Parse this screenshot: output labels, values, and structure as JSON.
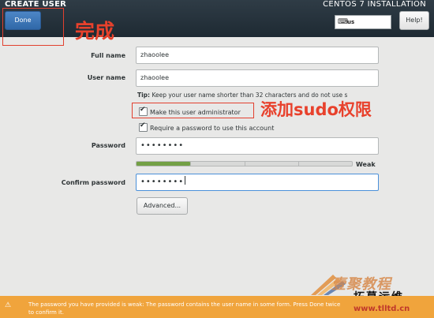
{
  "header": {
    "title": "CREATE USER",
    "done_label": "Done",
    "install_title": "CENTOS 7 INSTALLATION",
    "keyboard": {
      "icon": "keyboard-icon",
      "layout": "us"
    },
    "help_label": "Help!"
  },
  "form": {
    "full_name": {
      "label": "Full name",
      "value": "zhaoolee"
    },
    "user_name": {
      "label": "User name",
      "value": "zhaoolee"
    },
    "tip_prefix": "Tip:",
    "tip_text": " Keep your user name shorter than 32 characters and do not use s",
    "make_admin": {
      "label": "Make this user administrator",
      "checked": true
    },
    "require_password": {
      "label": "Require a password to use this account",
      "checked": true
    },
    "password": {
      "label": "Password",
      "value": "••••••••"
    },
    "strength": {
      "label": "Weak",
      "level": 0.25
    },
    "confirm_password": {
      "label": "Confirm password",
      "value": "••••••••"
    },
    "advanced_label": "Advanced..."
  },
  "annotations": {
    "done_note": "完成",
    "admin_note": "添加sudo权限"
  },
  "warning": {
    "text": "The password you have provided is weak: The password contains the user name in some form. Press Done twice to confirm it."
  },
  "watermark": {
    "line1": "壹聚教程",
    "line2": "拓幕运维",
    "line3": "www.tlltd.cn"
  },
  "colors": {
    "header_bg": "#26323b",
    "accent_blue": "#3a78bd",
    "annotation_red": "#e2402f",
    "warning_orange": "#f0a43c",
    "strength_green": "#73a045"
  }
}
